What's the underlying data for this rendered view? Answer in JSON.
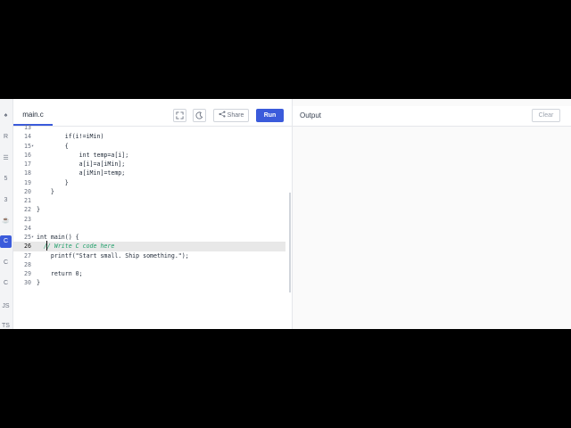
{
  "sidebar": {
    "items": [
      {
        "name": "python",
        "glyph": "♠"
      },
      {
        "name": "r",
        "glyph": "R"
      },
      {
        "name": "sql",
        "glyph": "☰"
      },
      {
        "name": "html",
        "glyph": "5"
      },
      {
        "name": "css",
        "glyph": "3"
      },
      {
        "name": "java",
        "glyph": "☕"
      },
      {
        "name": "kotlin",
        "glyph": "K"
      },
      {
        "name": "c",
        "glyph": "C"
      },
      {
        "name": "cpp",
        "glyph": "C"
      },
      {
        "name": "csharp",
        "glyph": "C"
      },
      {
        "name": "go",
        "glyph": "C"
      },
      {
        "name": "js",
        "glyph": "JS"
      },
      {
        "name": "ts",
        "glyph": "TS"
      }
    ]
  },
  "editor": {
    "file_tab": "main.c",
    "share_label": "Share",
    "run_label": "Run",
    "lines": [
      {
        "num": "13",
        "text": "",
        "fold": ""
      },
      {
        "num": "14",
        "text": "        if(i!=iMin)",
        "fold": ""
      },
      {
        "num": "15",
        "text": "        {",
        "fold": "▾"
      },
      {
        "num": "16",
        "text": "            int temp=a[i];",
        "fold": ""
      },
      {
        "num": "17",
        "text": "            a[i]=a[iMin];",
        "fold": ""
      },
      {
        "num": "18",
        "text": "            a[iMin]=temp;",
        "fold": ""
      },
      {
        "num": "19",
        "text": "        }",
        "fold": ""
      },
      {
        "num": "20",
        "text": "    }",
        "fold": ""
      },
      {
        "num": "21",
        "text": "",
        "fold": ""
      },
      {
        "num": "22",
        "text": "}",
        "fold": ""
      },
      {
        "num": "23",
        "text": "",
        "fold": ""
      },
      {
        "num": "24",
        "text": "",
        "fold": ""
      },
      {
        "num": "25",
        "text": "int main() {",
        "fold": "▾"
      },
      {
        "num": "26",
        "text": "  // Write C code here",
        "fold": ""
      },
      {
        "num": "27",
        "text": "    printf(\"Start small. Ship something.\");",
        "fold": ""
      },
      {
        "num": "28",
        "text": "",
        "fold": ""
      },
      {
        "num": "29",
        "text": "    return 0;",
        "fold": ""
      },
      {
        "num": "30",
        "text": "}",
        "fold": ""
      }
    ]
  },
  "output": {
    "title": "Output",
    "clear_label": "Clear"
  }
}
